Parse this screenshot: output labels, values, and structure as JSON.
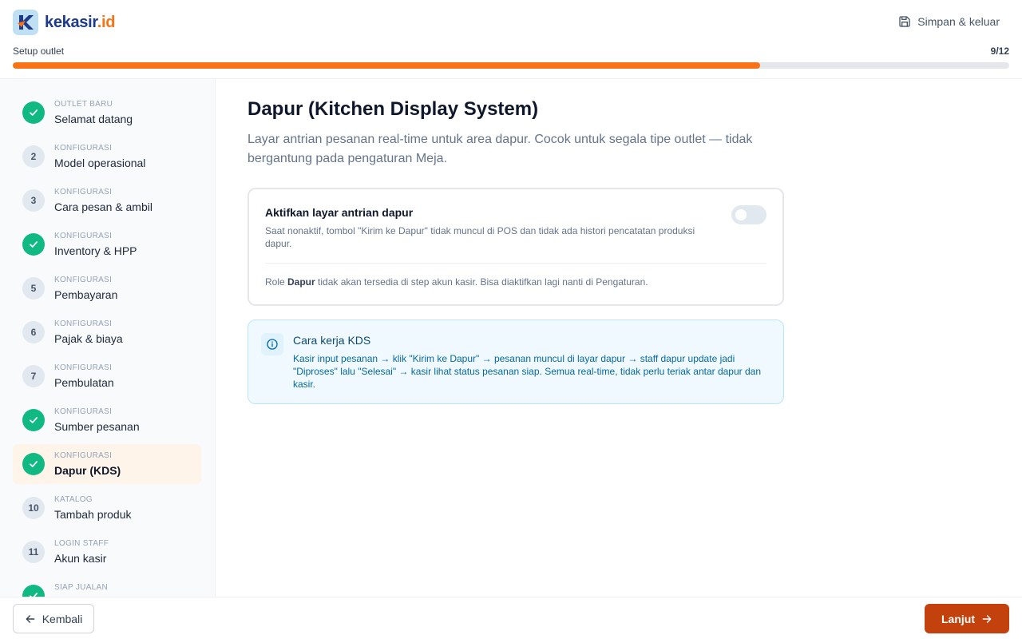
{
  "brand": {
    "name": "kekasir",
    "suffix": ".id",
    "accent": "#f97316",
    "primary": "#1e3a8a"
  },
  "header": {
    "save_exit_label": "Simpan & keluar",
    "save_icon": "floppy-disk-icon"
  },
  "progress": {
    "label": "Setup outlet",
    "count": "9/12",
    "value": 0.75
  },
  "steps": [
    {
      "category": "OUTLET BARU",
      "title": "Selamat datang",
      "status": "done",
      "number": "1"
    },
    {
      "category": "KONFIGURASI",
      "title": "Model operasional",
      "status": "pending",
      "number": "2"
    },
    {
      "category": "KONFIGURASI",
      "title": "Cara pesan & ambil",
      "status": "pending",
      "number": "3"
    },
    {
      "category": "KONFIGURASI",
      "title": "Inventory & HPP",
      "status": "done",
      "number": "4"
    },
    {
      "category": "KONFIGURASI",
      "title": "Pembayaran",
      "status": "pending",
      "number": "5"
    },
    {
      "category": "KONFIGURASI",
      "title": "Pajak & biaya",
      "status": "pending",
      "number": "6"
    },
    {
      "category": "KONFIGURASI",
      "title": "Pembulatan",
      "status": "pending",
      "number": "7"
    },
    {
      "category": "KONFIGURASI",
      "title": "Sumber pesanan",
      "status": "done",
      "number": "8"
    },
    {
      "category": "KONFIGURASI",
      "title": "Dapur (KDS)",
      "status": "done",
      "number": "9",
      "active": true
    },
    {
      "category": "KATALOG",
      "title": "Tambah produk",
      "status": "pending",
      "number": "10"
    },
    {
      "category": "LOGIN STAFF",
      "title": "Akun kasir",
      "status": "pending",
      "number": "11"
    },
    {
      "category": "SIAP JUALAN",
      "title": "",
      "status": "done",
      "number": "12"
    }
  ],
  "main": {
    "title": "Dapur (Kitchen Display System)",
    "description": "Layar antrian pesanan real-time untuk area dapur. Cocok untuk segala tipe outlet — tidak bergantung pada pengaturan Meja.",
    "toggle_card": {
      "title": "Aktifkan layar antrian dapur",
      "description": "Saat nonaktif, tombol \"Kirim ke Dapur\" tidak muncul di POS dan tidak ada histori pencatatan produksi dapur.",
      "enabled": false,
      "note_prefix": "Role ",
      "note_role": "Dapur",
      "note_suffix": " tidak akan tersedia di step akun kasir. Bisa diaktifkan lagi nanti di Pengaturan."
    },
    "info": {
      "icon": "info-icon",
      "title": "Cara kerja KDS",
      "body": "Kasir input pesanan → klik \"Kirim ke Dapur\" → pesanan muncul di layar dapur → staff dapur update jadi \"Diproses\" lalu \"Selesai\" → kasir lihat status pesanan siap. Semua real-time, tidak perlu teriak antar dapur dan kasir."
    }
  },
  "footer": {
    "back_label": "Kembali",
    "next_label": "Lanjut"
  }
}
